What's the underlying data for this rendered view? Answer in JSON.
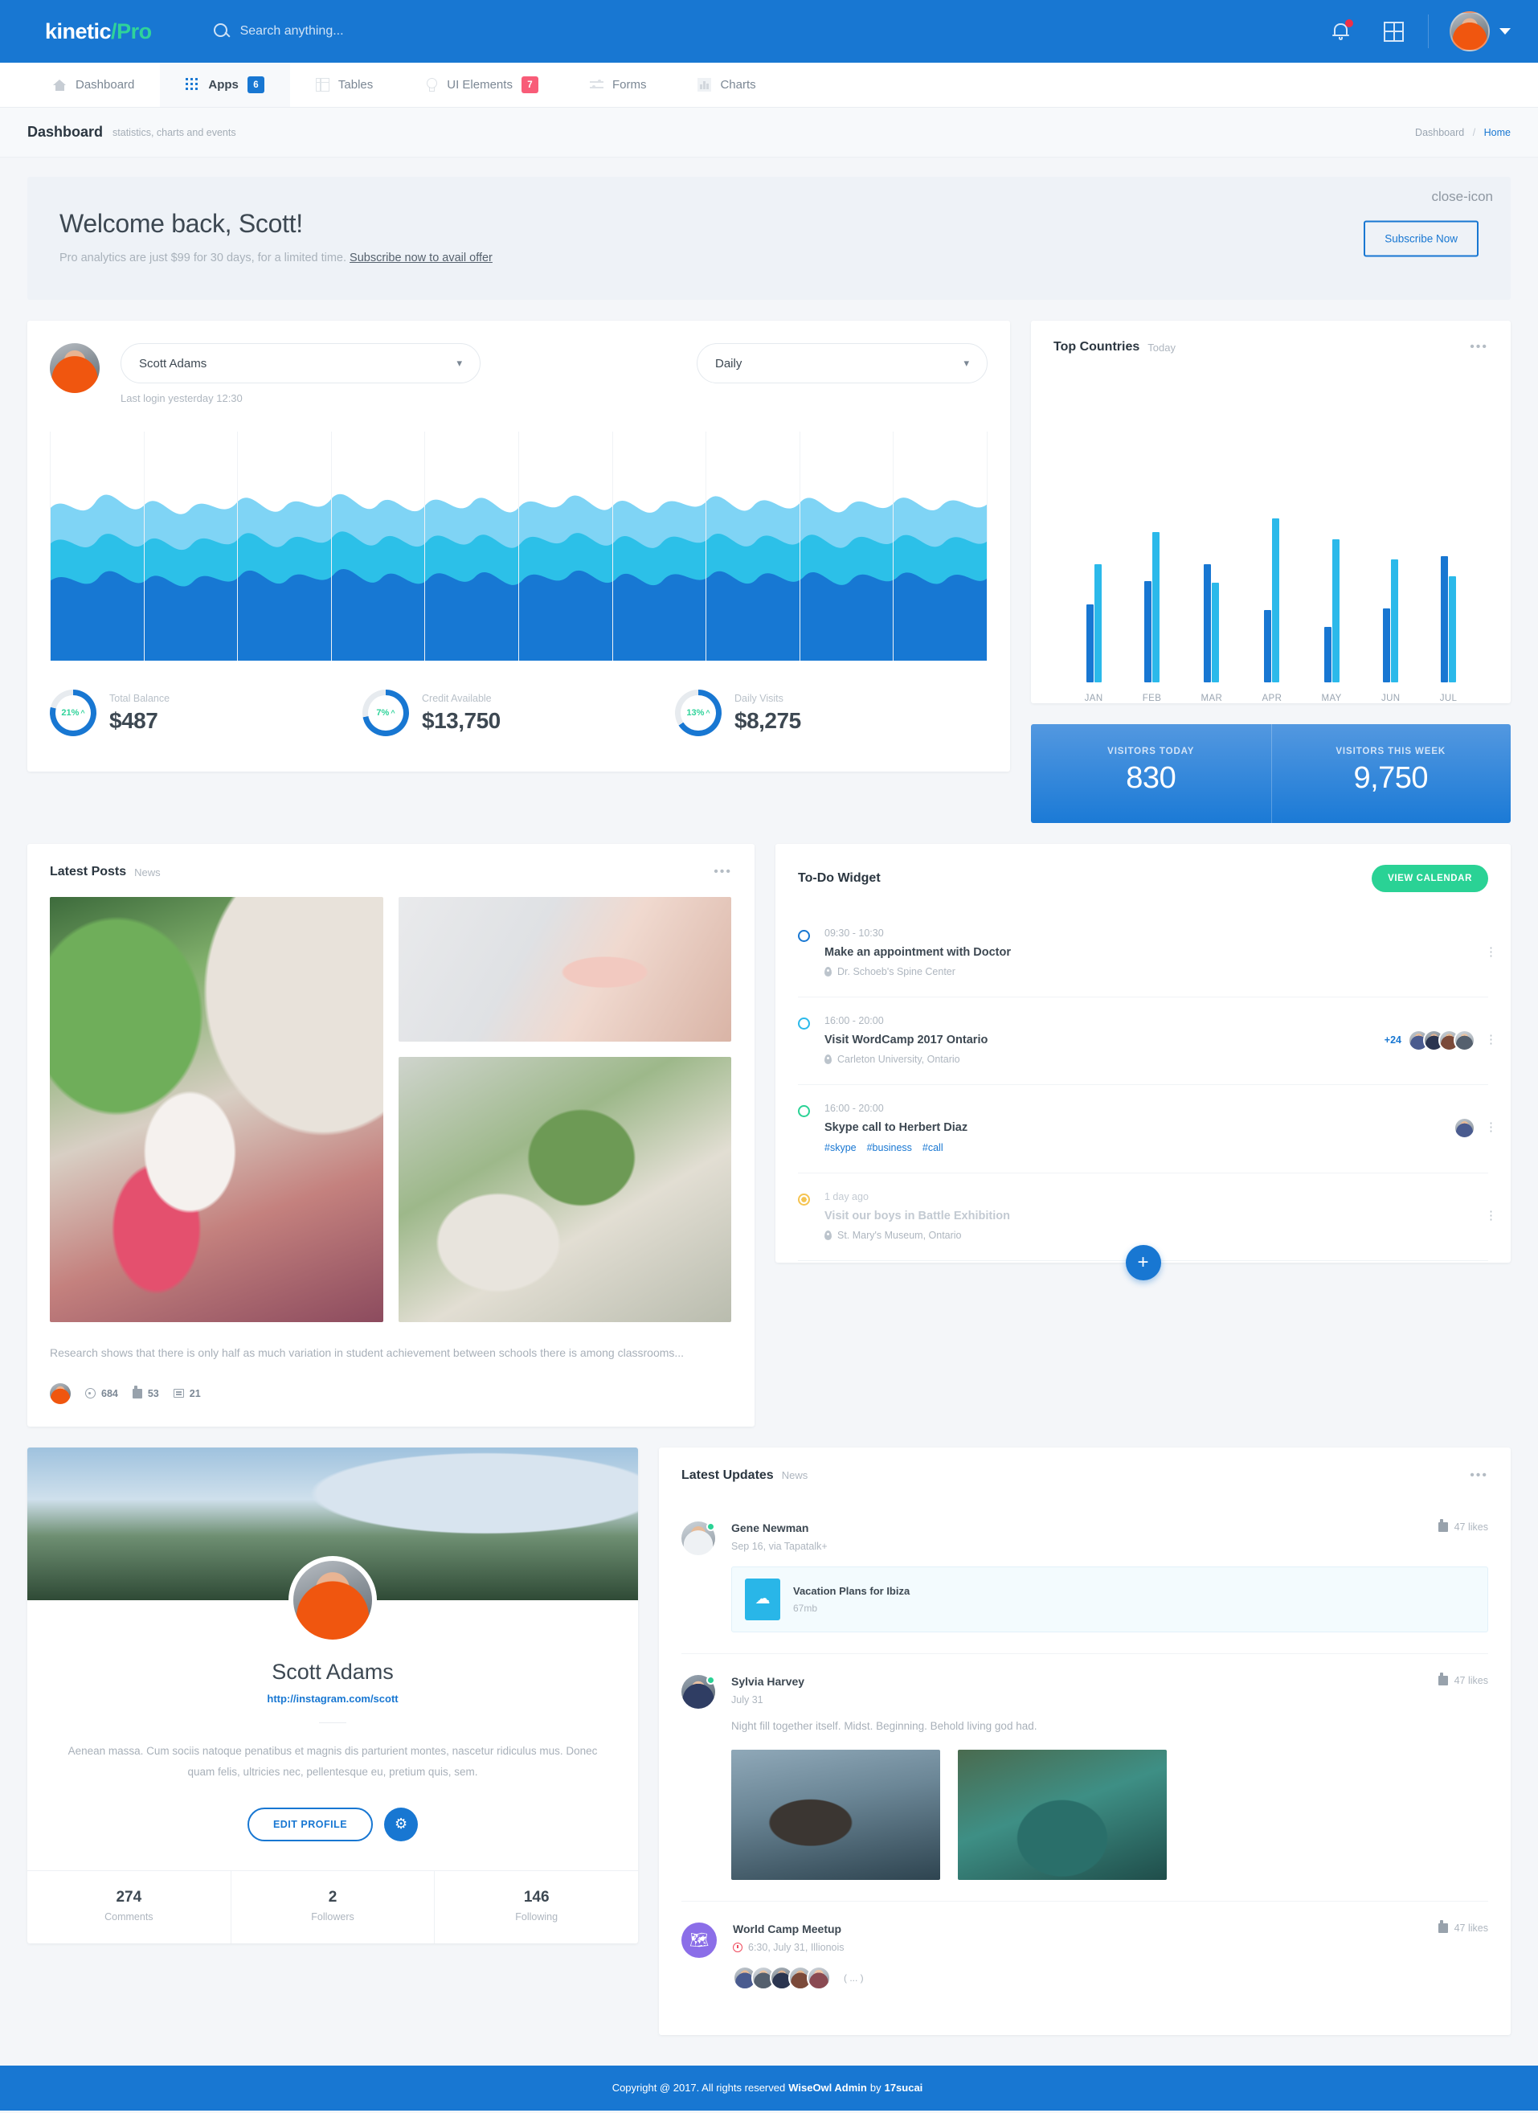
{
  "header": {
    "brand_left": "kinetic",
    "brand_slash": "/",
    "brand_right": "Pro",
    "search_placeholder": "Search anything...",
    "search_value": "",
    "search_icon": "search-icon",
    "bell_icon": "notification-bell-icon",
    "grid_icon": "apps-grid-icon",
    "avatar_icon": "user-avatar",
    "chevron_icon": "chevron-down-icon"
  },
  "nav": {
    "items": [
      {
        "label": "Dashboard",
        "icon": "home-icon",
        "badge": "",
        "active": false
      },
      {
        "label": "Apps",
        "icon": "apps-dots-icon",
        "badge": "6",
        "badge_color": "#1877d2",
        "active": true
      },
      {
        "label": "Tables",
        "icon": "table-icon",
        "badge": "",
        "active": false
      },
      {
        "label": "UI Elements",
        "icon": "lightbulb-icon",
        "badge": "7",
        "badge_color": "#f85c78",
        "active": false
      },
      {
        "label": "Forms",
        "icon": "sliders-icon",
        "badge": "",
        "active": false
      },
      {
        "label": "Charts",
        "icon": "bar-chart-icon",
        "badge": "",
        "active": false
      }
    ]
  },
  "pagehead": {
    "title": "Dashboard",
    "subtitle": "statistics, charts and events",
    "crumb_parent": "Dashboard",
    "crumb_sep": "/",
    "crumb_current": "Home"
  },
  "banner": {
    "heading": "Welcome back, Scott!",
    "text": "Pro analytics are just $99 for 30 days, for a limited time.",
    "link": "Subscribe now to avail offer",
    "button": "Subscribe Now",
    "close_icon": "close-icon"
  },
  "analytics": {
    "user_select": "Scott Adams",
    "last_login": "Last login yesterday 12:30",
    "period_select": "Daily",
    "chart_data": {
      "type": "area",
      "title": "",
      "xlabel": "",
      "ylabel": "",
      "grid": true,
      "series": [
        {
          "name": "Series A",
          "color": "#1778d3",
          "values": [
            60,
            62,
            58,
            64,
            61,
            66,
            60,
            63,
            59,
            65,
            62,
            60,
            58,
            63,
            61,
            64,
            60,
            62,
            59,
            63
          ]
        },
        {
          "name": "Series B",
          "color": "#2cc0e8",
          "values": [
            78,
            72,
            80,
            74,
            84,
            70,
            82,
            76,
            86,
            72,
            80,
            78,
            74,
            82,
            76,
            84,
            72,
            80,
            74,
            78
          ]
        },
        {
          "name": "Series C",
          "color": "#7fd4f5",
          "values": [
            92,
            86,
            96,
            88,
            98,
            84,
            94,
            90,
            100,
            86,
            95,
            92,
            88,
            97,
            90,
            99,
            86,
            94,
            88,
            93
          ]
        }
      ]
    },
    "stats": [
      {
        "pct": "21%",
        "arrow": "^",
        "label": "Total Balance",
        "value": "$487",
        "ring_pct": 79
      },
      {
        "pct": "7%",
        "arrow": "^",
        "label": "Credit Available",
        "value": "$13,750",
        "ring_pct": 72
      },
      {
        "pct": "13%",
        "arrow": "^",
        "label": "Daily Visits",
        "value": "$8,275",
        "ring_pct": 66
      }
    ]
  },
  "countries": {
    "title": "Top Countries",
    "subtitle": "Today",
    "menu_icon": "more-dots-icon",
    "chart_data": {
      "type": "bar",
      "title": "Top Countries",
      "categories": [
        "JAN",
        "FEB",
        "MAR",
        "APR",
        "MAY",
        "JUN",
        "JUL"
      ],
      "xlabel": "",
      "ylabel": "",
      "ylim": [
        0,
        100
      ],
      "grid": false,
      "legend": "none",
      "series": [
        {
          "name": "Series A",
          "color": "#1877d2",
          "values": [
            46,
            60,
            70,
            43,
            33,
            44,
            75
          ]
        },
        {
          "name": "Series B",
          "color": "#2bb9ea",
          "values": [
            70,
            89,
            59,
            97,
            85,
            73,
            63
          ]
        }
      ]
    },
    "visitors": [
      {
        "label": "VISITORS TODAY",
        "value": "830"
      },
      {
        "label": "VISITORS THIS WEEK",
        "value": "9,750"
      }
    ]
  },
  "posts": {
    "title": "Latest Posts",
    "subtitle": "News",
    "menu_icon": "more-dots-icon",
    "text": "Research shows that there is only half as much variation in student achievement between schools there is among classrooms...",
    "views": "684",
    "likes": "53",
    "comments": "21",
    "views_icon": "eye-icon",
    "likes_icon": "thumbs-up-icon",
    "comments_icon": "comment-icon"
  },
  "todo": {
    "title": "To-Do Widget",
    "calendar_button": "VIEW CALENDAR",
    "add_button": "+",
    "items": [
      {
        "time": "09:30 - 10:30",
        "title": "Make an appointment with Doctor",
        "location": "Dr. Schoeb's Spine Center",
        "dot": "blue",
        "extra_count": "",
        "tags": [],
        "faded": false
      },
      {
        "time": "16:00 - 20:00",
        "title": "Visit WordCamp 2017 Ontario",
        "location": "Carleton University, Ontario",
        "dot": "cyan",
        "extra_count": "+24",
        "tags": [],
        "faded": false
      },
      {
        "time": "16:00 - 20:00",
        "title": "Skype call to Herbert Diaz",
        "location": "",
        "dot": "green",
        "extra_count": "",
        "tags": [
          "#skype",
          "#business",
          "#call"
        ],
        "faded": false
      },
      {
        "time": "1 day ago",
        "title": "Visit our boys in Battle Exhibition",
        "location": "St. Mary's Museum, Ontario",
        "dot": "amber",
        "extra_count": "",
        "tags": [],
        "faded": true
      }
    ]
  },
  "profile": {
    "name": "Scott Adams",
    "link": "http://instagram.com/scott",
    "bio": "Aenean massa. Cum sociis natoque penatibus et magnis dis parturient montes, nascetur ridiculus mus. Donec quam felis, ultricies nec, pellentesque eu, pretium quis, sem.",
    "edit_button": "EDIT PROFILE",
    "gear_icon": "gear-icon",
    "stats": [
      {
        "number": "274",
        "label": "Comments"
      },
      {
        "number": "2",
        "label": "Followers"
      },
      {
        "number": "146",
        "label": "Following"
      }
    ]
  },
  "updates": {
    "title": "Latest Updates",
    "subtitle": "News",
    "menu_icon": "more-dots-icon",
    "items": [
      {
        "name": "Gene Newman",
        "meta": "Sep 16, via Tapatalk+",
        "likes": "47 likes",
        "attachment_name": "Vacation Plans for Ibiza",
        "attachment_size": "67mb",
        "attachment_icon": "cloud-download-icon"
      },
      {
        "name": "Sylvia Harvey",
        "meta": "July 31",
        "likes": "47 likes",
        "text": "Night fill together itself. Midst. Beginning. Behold living god had."
      },
      {
        "name": "World Camp Meetup",
        "meta": "6:30, July 31, Illionois",
        "likes": "47 likes",
        "icon": "map-icon",
        "more": "( ... )"
      }
    ]
  },
  "footer": {
    "text_before": "Copyright @ 2017. All rights reserved",
    "bold1": "WiseOwl Admin",
    "middle": "by",
    "bold2": "17sucai"
  }
}
